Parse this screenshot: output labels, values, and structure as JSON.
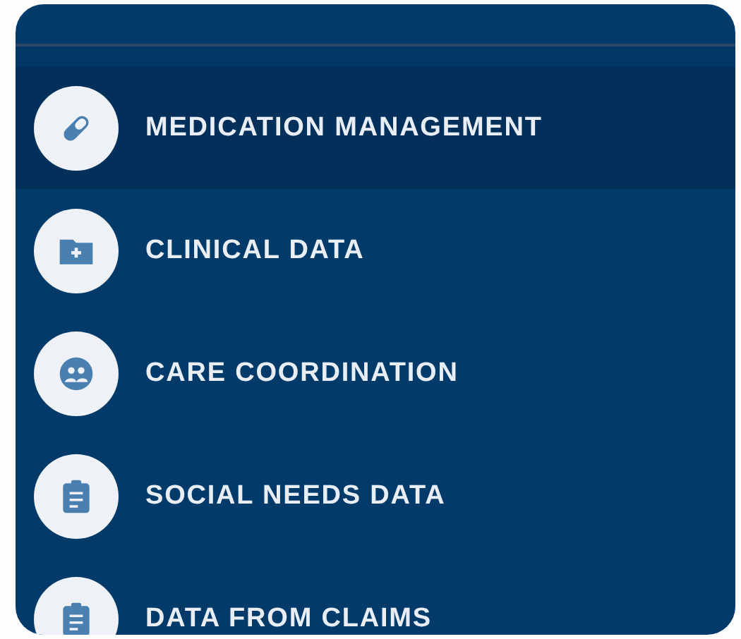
{
  "menu": {
    "items": [
      {
        "label": "MEDICATION MANAGEMENT",
        "selected": true
      },
      {
        "label": "CLINICAL DATA",
        "selected": false
      },
      {
        "label": "CARE COORDINATION",
        "selected": false
      },
      {
        "label": "SOCIAL NEEDS DATA",
        "selected": false
      },
      {
        "label": "DATA FROM CLAIMS",
        "selected": false
      }
    ]
  }
}
